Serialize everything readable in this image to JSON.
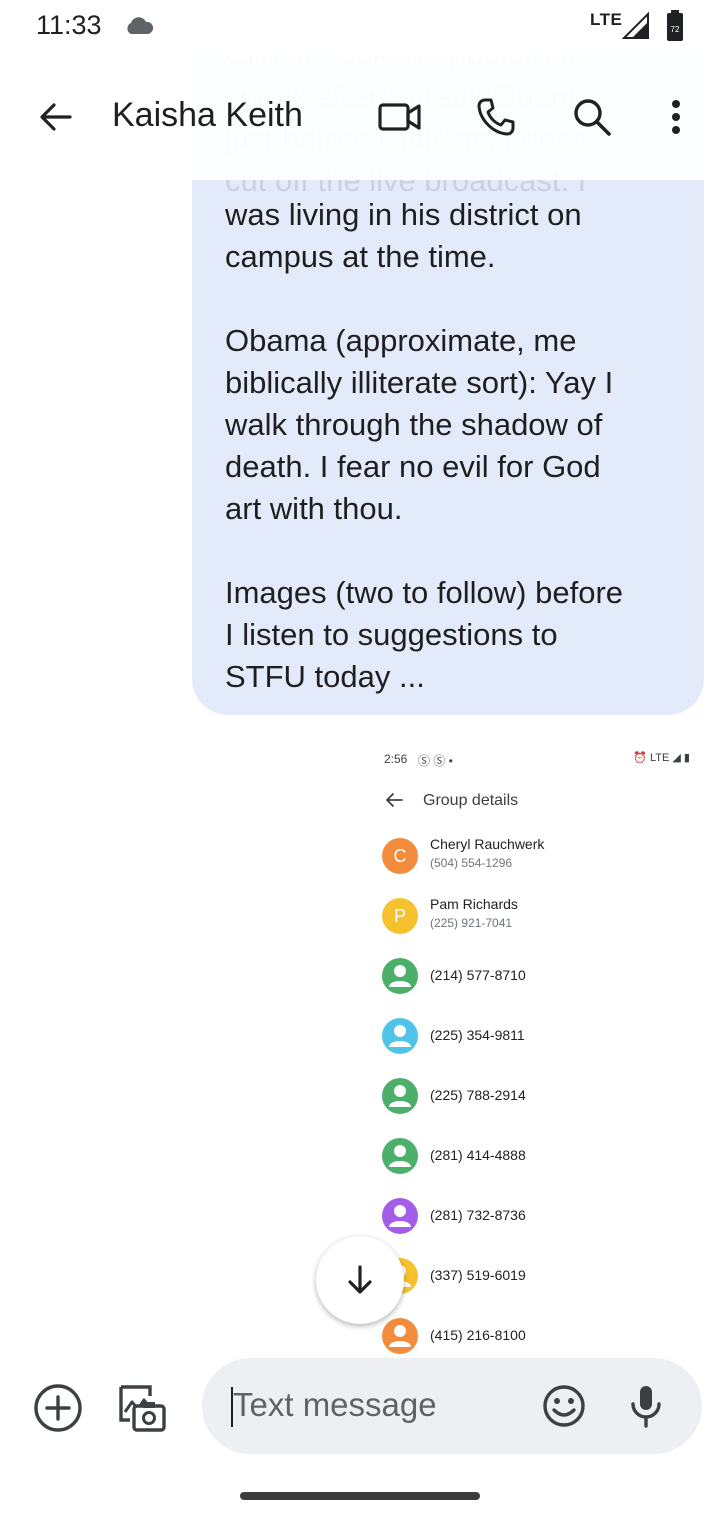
{
  "status_bar": {
    "time": "11:33",
    "network": "LTE",
    "battery_level": "72",
    "icons": [
      "cloud-icon",
      "signal-icon",
      "battery-icon"
    ]
  },
  "app_bar": {
    "contact_name": "Kaisha Keith",
    "icons": [
      "back-arrow-icon",
      "video-camera-icon",
      "phone-icon",
      "search-icon",
      "more-vert-icon"
    ]
  },
  "message": {
    "faded_top_text": "and civil rights hero. Hillary\nClinton took the podium to\nspeak after Barack Obama\njust before CNN next door\ncut off the live broadcast. I",
    "visible_text": "was living in his district on\ncampus at the time.\n\nObama (approximate, me\nbiblically illiterate sort): Yay I\nwalk through the shadow of\ndeath. I fear no evil for God\nart with thou.\n\nImages (two to follow) before\nI listen to suggestions to\nSTFU today ...",
    "bubble_color": "#e3ebfb"
  },
  "attachment": {
    "time": "2:56",
    "status_icons": "Ⓢ Ⓢ •",
    "right_icons": "⏰ LTE ◢ ▮",
    "title": "Group details",
    "members": [
      {
        "initial": "C",
        "name": "Cheryl Rauchwerk",
        "phone": "(504) 554-1296",
        "color": "#f28b3c"
      },
      {
        "initial": "P",
        "name": "Pam Richards",
        "phone": "(225) 921-7041",
        "color": "#f6c12f"
      },
      {
        "initial": "",
        "name": "",
        "phone": "(214) 577-8710",
        "color": "#4caf6a"
      },
      {
        "initial": "",
        "name": "",
        "phone": "(225) 354-9811",
        "color": "#4fc3e8"
      },
      {
        "initial": "",
        "name": "",
        "phone": "(225) 788-2914",
        "color": "#4caf6a"
      },
      {
        "initial": "",
        "name": "",
        "phone": "(281) 414-4888",
        "color": "#4caf6a"
      },
      {
        "initial": "",
        "name": "",
        "phone": "(281) 732-8736",
        "color": "#a25ee8"
      },
      {
        "initial": "",
        "name": "",
        "phone": "(337) 519-6019",
        "color": "#f6c12f"
      },
      {
        "initial": "",
        "name": "",
        "phone": "(415) 216-8100",
        "color": "#f28b3c"
      }
    ]
  },
  "scroll_fab": {
    "icon": "arrow-down-icon"
  },
  "compose": {
    "placeholder": "Text message",
    "icons": [
      "add-circle-icon",
      "gallery-camera-icon",
      "emoji-icon",
      "mic-icon"
    ]
  }
}
